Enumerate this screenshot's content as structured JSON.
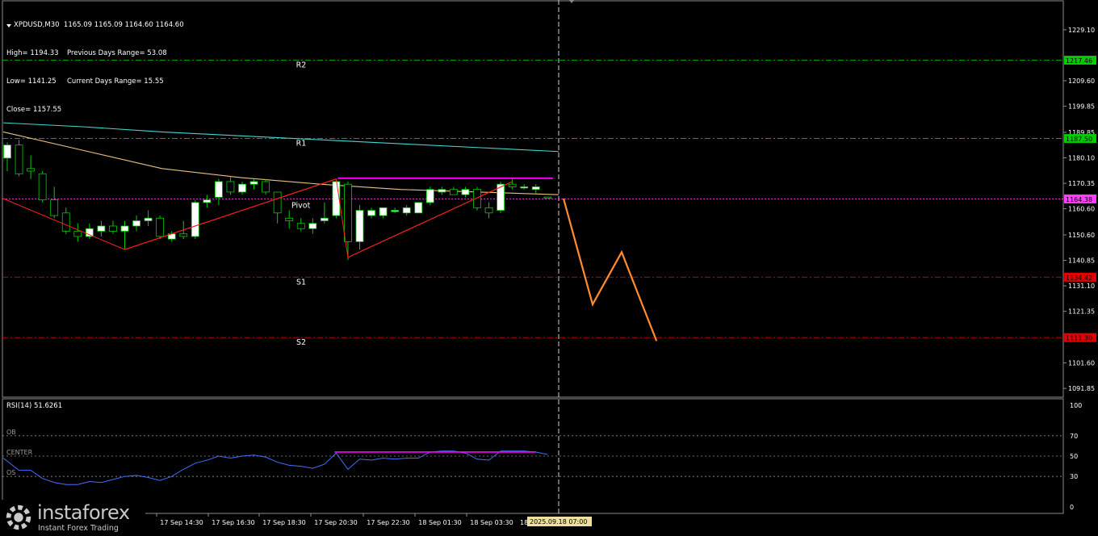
{
  "header": {
    "symbol_line": "XPDUSD,M30  1165.09 1165.09 1164.60 1164.60",
    "rows": [
      {
        "left": "High= 1194.33",
        "right": "Previous Days Range= 53.08"
      },
      {
        "left": "Low= 1141.25",
        "right": "Current Days Range= 15.55"
      },
      {
        "left": "Close= 1157.55",
        "right": ""
      }
    ]
  },
  "rsi_label": "RSI(14) 51.6261",
  "watermark": {
    "brand": "instaforex",
    "tagline": "Instant Forex Trading"
  },
  "colors": {
    "background": "#000000",
    "frame": "#8c8c8c",
    "bull_candle": "#ffffff",
    "bear_candle": "#000000",
    "candle_border": "#00cc00",
    "ma_fast": "#e8c080",
    "ma_slow": "#40d8d0",
    "pattern_line": "#ff2020",
    "resistance_mark": "#ff00ff",
    "forecast": "#ff8c30",
    "rsi_line": "#4070ff",
    "level_green": "#00cc00",
    "level_red": "#e00000",
    "current_price": "#ff40ff",
    "date_tag": "#f0e0a0"
  },
  "chart_data": [
    {
      "type": "candlestick",
      "title": "XPDUSD,M30",
      "price_axis_ticks": [
        1229.1,
        1209.6,
        1199.85,
        1189.85,
        1180.1,
        1170.35,
        1160.6,
        1150.6,
        1140.85,
        1131.1,
        1121.35,
        1101.6,
        1091.85
      ],
      "ylim": [
        1088.5,
        1240.5
      ],
      "x_tick_labels": [
        "17 Sep 14:30",
        "17 Sep 16:30",
        "17 Sep 18:30",
        "17 Sep 20:30",
        "17 Sep 22:30",
        "18 Sep 01:30",
        "18 Sep 03:30",
        "18 Sep 05:30"
      ],
      "current_time_label": "2025.09.18 07:00",
      "candles": [
        {
          "o": 1180,
          "h": 1186,
          "l": 1175,
          "c": 1185
        },
        {
          "o": 1185,
          "h": 1187,
          "l": 1173,
          "c": 1174
        },
        {
          "o": 1176,
          "h": 1181,
          "l": 1172,
          "c": 1175
        },
        {
          "o": 1174,
          "h": 1175,
          "l": 1163,
          "c": 1164
        },
        {
          "o": 1164,
          "h": 1169,
          "l": 1157,
          "c": 1158
        },
        {
          "o": 1159,
          "h": 1161,
          "l": 1151,
          "c": 1152
        },
        {
          "o": 1152,
          "h": 1155,
          "l": 1148,
          "c": 1150
        },
        {
          "o": 1150,
          "h": 1155,
          "l": 1149,
          "c": 1153
        },
        {
          "o": 1152,
          "h": 1156,
          "l": 1150,
          "c": 1154
        },
        {
          "o": 1154,
          "h": 1156,
          "l": 1151,
          "c": 1152
        },
        {
          "o": 1152,
          "h": 1156,
          "l": 1145,
          "c": 1154
        },
        {
          "o": 1154,
          "h": 1158,
          "l": 1152,
          "c": 1156
        },
        {
          "o": 1156,
          "h": 1160,
          "l": 1154,
          "c": 1157
        },
        {
          "o": 1157,
          "h": 1158,
          "l": 1149,
          "c": 1150
        },
        {
          "o": 1149,
          "h": 1152,
          "l": 1148,
          "c": 1151
        },
        {
          "o": 1151,
          "h": 1156,
          "l": 1149,
          "c": 1150
        },
        {
          "o": 1150,
          "h": 1164,
          "l": 1149,
          "c": 1163
        },
        {
          "o": 1163,
          "h": 1166,
          "l": 1161,
          "c": 1164
        },
        {
          "o": 1165,
          "h": 1172,
          "l": 1162,
          "c": 1171
        },
        {
          "o": 1171,
          "h": 1173,
          "l": 1166,
          "c": 1167
        },
        {
          "o": 1167,
          "h": 1171,
          "l": 1166,
          "c": 1170
        },
        {
          "o": 1170,
          "h": 1172,
          "l": 1168,
          "c": 1171
        },
        {
          "o": 1171,
          "h": 1172,
          "l": 1166,
          "c": 1167
        },
        {
          "o": 1167,
          "h": 1167,
          "l": 1155,
          "c": 1159
        },
        {
          "o": 1157,
          "h": 1160,
          "l": 1153,
          "c": 1156
        },
        {
          "o": 1155,
          "h": 1157,
          "l": 1152,
          "c": 1153
        },
        {
          "o": 1153,
          "h": 1157,
          "l": 1151,
          "c": 1155
        },
        {
          "o": 1156,
          "h": 1163,
          "l": 1155,
          "c": 1157
        },
        {
          "o": 1158,
          "h": 1172,
          "l": 1157,
          "c": 1171
        },
        {
          "o": 1170,
          "h": 1171,
          "l": 1141,
          "c": 1148
        },
        {
          "o": 1148,
          "h": 1162,
          "l": 1145,
          "c": 1160
        },
        {
          "o": 1158,
          "h": 1161,
          "l": 1157,
          "c": 1160
        },
        {
          "o": 1158,
          "h": 1161,
          "l": 1157,
          "c": 1161
        },
        {
          "o": 1160,
          "h": 1161,
          "l": 1159,
          "c": 1160
        },
        {
          "o": 1159,
          "h": 1162,
          "l": 1158,
          "c": 1161
        },
        {
          "o": 1159,
          "h": 1163,
          "l": 1159,
          "c": 1163
        },
        {
          "o": 1163,
          "h": 1169,
          "l": 1162,
          "c": 1168
        },
        {
          "o": 1167,
          "h": 1169,
          "l": 1166,
          "c": 1168
        },
        {
          "o": 1168,
          "h": 1169,
          "l": 1166,
          "c": 1166
        },
        {
          "o": 1166,
          "h": 1169,
          "l": 1165,
          "c": 1168
        },
        {
          "o": 1168,
          "h": 1169,
          "l": 1160,
          "c": 1161
        },
        {
          "o": 1161,
          "h": 1163,
          "l": 1157,
          "c": 1159
        },
        {
          "o": 1160,
          "h": 1171,
          "l": 1159,
          "c": 1170
        },
        {
          "o": 1170,
          "h": 1172,
          "l": 1168,
          "c": 1169
        },
        {
          "o": 1169,
          "h": 1170,
          "l": 1168,
          "c": 1169
        },
        {
          "o": 1168,
          "h": 1170,
          "l": 1166,
          "c": 1169
        },
        {
          "o": 1165.09,
          "h": 1165.09,
          "l": 1164.6,
          "c": 1164.6
        }
      ],
      "moving_averages": [
        {
          "color_key": "ma_slow",
          "values": [
            1193.5,
            1192,
            1190,
            1188.5,
            1187,
            1185.5,
            1184,
            1182.5
          ]
        },
        {
          "color_key": "ma_fast",
          "values": [
            1190,
            1183,
            1176,
            1172.5,
            1170,
            1168,
            1167,
            1166
          ]
        }
      ],
      "levels": [
        {
          "label": "R2",
          "price": 1217.46,
          "tag": "1217.46",
          "color_key": "level_green"
        },
        {
          "label": "R1",
          "price": 1187.5,
          "tag": "1187.50",
          "color_key": "level_green"
        },
        {
          "label": "Pivot",
          "price": 1164.38,
          "tag": "1164.38",
          "color_key": "current_price"
        },
        {
          "label": "S1",
          "price": 1134.42,
          "tag": "1134.42",
          "color_key": "level_red"
        },
        {
          "label": "S2",
          "price": 1111.3,
          "tag": "1111.30",
          "color_key": "level_red"
        }
      ],
      "pattern_points": [
        [
          0,
          1164.5
        ],
        [
          10,
          1145
        ],
        [
          28,
          1172
        ],
        [
          29,
          1142
        ],
        [
          43,
          1171
        ]
      ],
      "resistance_segment": {
        "from": 28,
        "to": 47,
        "price": 1172
      },
      "forecast_path": [
        [
          1164.5,
          0
        ],
        [
          1124,
          2.5
        ],
        [
          1144,
          5
        ],
        [
          1110,
          8
        ]
      ]
    },
    {
      "type": "line",
      "title": "RSI(14) 51.6261",
      "ylim": [
        0,
        100
      ],
      "tick_labels": [
        "100",
        "70",
        "50",
        "30",
        "0"
      ],
      "tick_values": [
        100,
        70,
        50,
        30,
        0
      ],
      "guide_labels": [
        {
          "label": "OB",
          "value": 70
        },
        {
          "label": "CENTER",
          "value": 50
        },
        {
          "label": "OS",
          "value": 30
        }
      ],
      "values": [
        48,
        36,
        36,
        28,
        24,
        22,
        22,
        25,
        24,
        27,
        30,
        31,
        29,
        26,
        30,
        37,
        43,
        46,
        50,
        48,
        50,
        51,
        49,
        44,
        41,
        40,
        38,
        42,
        53,
        37,
        47,
        46,
        48,
        47,
        48,
        48,
        54,
        55,
        55,
        53,
        47,
        46,
        55,
        55,
        55,
        54,
        51.6261
      ],
      "resistance_segment": {
        "from": 28,
        "to": 45,
        "value": 54
      }
    }
  ]
}
